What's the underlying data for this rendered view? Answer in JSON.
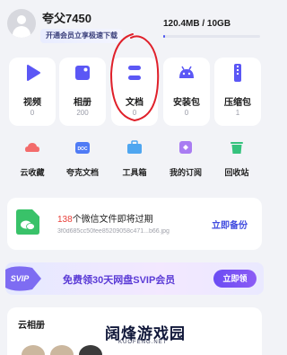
{
  "header": {
    "username": "夸父7450",
    "vip_tag": "开通会员立享极速下载",
    "storage_text": "120.4MB / 10GB",
    "storage_used_fraction": 0.012
  },
  "file_types": [
    {
      "label": "视频",
      "count": "0",
      "icon": "video-play-icon",
      "color": "#5b57f5"
    },
    {
      "label": "相册",
      "count": "200",
      "icon": "image-icon",
      "color": "#5b57f5"
    },
    {
      "label": "文档",
      "count": "0",
      "icon": "document-icon",
      "color": "#5b57f5"
    },
    {
      "label": "安装包",
      "count": "0",
      "icon": "android-icon",
      "color": "#5b57f5"
    },
    {
      "label": "压缩包",
      "count": "1",
      "icon": "zip-icon",
      "color": "#5b57f5"
    }
  ],
  "tools": [
    {
      "label": "云收藏",
      "icon": "cloud-favorite-icon",
      "color": "#f36b6b"
    },
    {
      "label": "夸克文档",
      "icon": "quark-doc-icon",
      "color": "#4f7bf5"
    },
    {
      "label": "工具箱",
      "icon": "toolbox-icon",
      "color": "#4fa6f0"
    },
    {
      "label": "我的订阅",
      "icon": "subscription-icon",
      "color": "#a97cf2"
    },
    {
      "label": "回收站",
      "icon": "recycle-bin-icon",
      "color": "#35c27d"
    }
  ],
  "wechat": {
    "count": "138",
    "title_rest": "个微信文件即将过期",
    "subtitle": "3f0d685cc50fee85209058c471...b66.jpg",
    "action": "立即备份"
  },
  "banner": {
    "badge": "SVIP",
    "text": "免费领30天网盘SVIP会员",
    "button": "立即领"
  },
  "album": {
    "title": "云相册"
  },
  "watermark": {
    "text": "阔烽游戏园",
    "sub": "KUOFENG.NET"
  },
  "colors": {
    "accent": "#4a55f0",
    "annotation": "#e0202a"
  }
}
